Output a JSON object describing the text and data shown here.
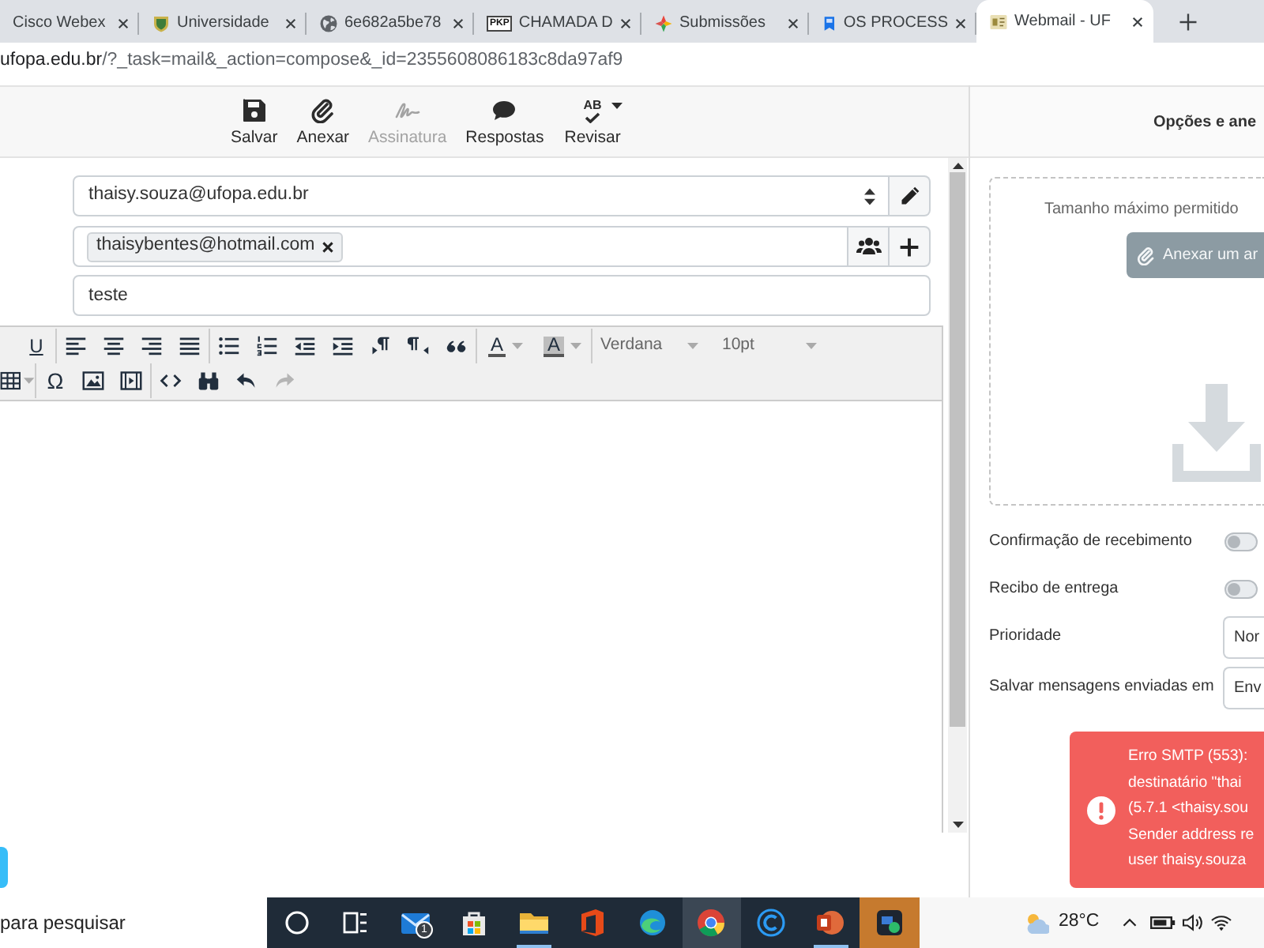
{
  "browser": {
    "tabs": [
      {
        "title": "Cisco Webex",
        "selected": false
      },
      {
        "title": "Universidade",
        "selected": false,
        "favicon": {
          "kind": "shield"
        }
      },
      {
        "title": "6e682a5be78",
        "selected": false,
        "favicon": {
          "kind": "globe"
        }
      },
      {
        "title": "CHAMADA D",
        "selected": false,
        "favicon": {
          "kind": "text-logo",
          "text": "PKP"
        }
      },
      {
        "title": "Submissões",
        "selected": false,
        "favicon": {
          "kind": "pinwheel"
        }
      },
      {
        "title": "OS PROCESS",
        "selected": false,
        "favicon": {
          "kind": "bookmark"
        }
      },
      {
        "title": "Webmail - UF",
        "selected": true,
        "favicon": {
          "kind": "picture-tile"
        }
      }
    ],
    "address": {
      "host": "ufopa.edu.br",
      "path": "/?_task=mail&_action=compose&_id=2355608086183c8da97af9"
    }
  },
  "toolbar": {
    "buttons": [
      {
        "kind": "save",
        "label": "Salvar",
        "disabled": false
      },
      {
        "kind": "attach",
        "label": "Anexar",
        "disabled": false
      },
      {
        "kind": "signature",
        "label": "Assinatura",
        "disabled": true
      },
      {
        "kind": "responses",
        "label": "Respostas",
        "disabled": false
      },
      {
        "kind": "spellcheck",
        "label": "Revisar",
        "disabled": false,
        "icon_text": "AB",
        "dropdown": true
      }
    ]
  },
  "compose": {
    "from": {
      "value": "thaisy.souza@ufopa.edu.br"
    },
    "to": {
      "recipients": [
        {
          "address": "thaisybentes@hotmail.com"
        }
      ]
    },
    "subject": {
      "value": "teste"
    }
  },
  "editor": {
    "toolbar_rows": [
      [
        [
          {
            "kind": "underline",
            "label": "U",
            "disabled": false
          }
        ],
        [
          {
            "kind": "align-left",
            "disabled": false
          },
          {
            "kind": "align-center",
            "disabled": false
          },
          {
            "kind": "align-right",
            "disabled": false
          },
          {
            "kind": "justify",
            "disabled": false
          }
        ],
        [
          {
            "kind": "bullet-list",
            "disabled": false
          },
          {
            "kind": "numbered-list",
            "disabled": false
          },
          {
            "kind": "outdent",
            "disabled": false
          },
          {
            "kind": "indent",
            "disabled": false
          },
          {
            "kind": "ltr",
            "disabled": false
          },
          {
            "kind": "rtl",
            "disabled": false
          },
          {
            "kind": "blockquote",
            "disabled": false
          }
        ],
        [
          {
            "kind": "text-color",
            "label": "A",
            "dropdown": true,
            "disabled": false
          },
          {
            "kind": "background-color",
            "label": "A",
            "dropdown": true,
            "disabled": false
          }
        ],
        [
          {
            "kind": "select",
            "label": "Verdana",
            "disabled": false
          },
          {
            "kind": "select",
            "label": "10pt",
            "disabled": false
          }
        ]
      ],
      [
        [
          {
            "kind": "table",
            "dropdown": true,
            "disabled": false
          }
        ],
        [
          {
            "kind": "special-character",
            "label": "Ω",
            "disabled": false
          },
          {
            "kind": "image",
            "disabled": false
          },
          {
            "kind": "media",
            "disabled": false
          }
        ],
        [
          {
            "kind": "code",
            "disabled": false
          },
          {
            "kind": "find",
            "disabled": false
          },
          {
            "kind": "undo",
            "disabled": false
          },
          {
            "kind": "redo",
            "disabled": true
          }
        ]
      ]
    ]
  },
  "options_panel": {
    "title": "Opções e ane",
    "dropzone": {
      "hint": "Tamanho máximo permitido",
      "button": "Anexar um ar"
    },
    "options": [
      {
        "kind": "switch",
        "label": "Confirmação de recebimento",
        "on": false
      },
      {
        "kind": "switch",
        "label": "Recibo de entrega",
        "on": false
      },
      {
        "kind": "select",
        "label": "Prioridade",
        "value": "Nor"
      },
      {
        "kind": "select",
        "label": "Salvar mensagens enviadas em",
        "value": "Env"
      }
    ]
  },
  "error_toast": {
    "lines": [
      "Erro SMTP (553):",
      "destinatário \"thai",
      "(5.7.1 <thaisy.sou",
      "Sender address re",
      "user thaisy.souza"
    ]
  },
  "taskbar": {
    "search": {
      "placeholder": "para pesquisar"
    },
    "apps": [
      {
        "kind": "ring",
        "running": false,
        "focused": false,
        "flashing": false
      },
      {
        "kind": "task-view",
        "running": false,
        "focused": false,
        "flashing": false
      },
      {
        "kind": "envelope",
        "running": false,
        "focused": false,
        "flashing": false,
        "badge": "1"
      },
      {
        "kind": "shopping-bag",
        "running": false,
        "focused": false,
        "flashing": false
      },
      {
        "kind": "folder",
        "running": true,
        "focused": false,
        "flashing": false
      },
      {
        "kind": "office",
        "running": false,
        "focused": false,
        "flashing": false
      },
      {
        "kind": "swirl",
        "running": false,
        "focused": false,
        "flashing": false
      },
      {
        "kind": "color-wheel",
        "running": false,
        "focused": true,
        "flashing": false
      },
      {
        "kind": "c-ring",
        "running": false,
        "focused": false,
        "flashing": false
      },
      {
        "kind": "presentation",
        "running": true,
        "focused": false,
        "flashing": false
      },
      {
        "kind": "chat-tile",
        "running": false,
        "focused": false,
        "flashing": true
      }
    ],
    "temperature": "28°C"
  }
}
